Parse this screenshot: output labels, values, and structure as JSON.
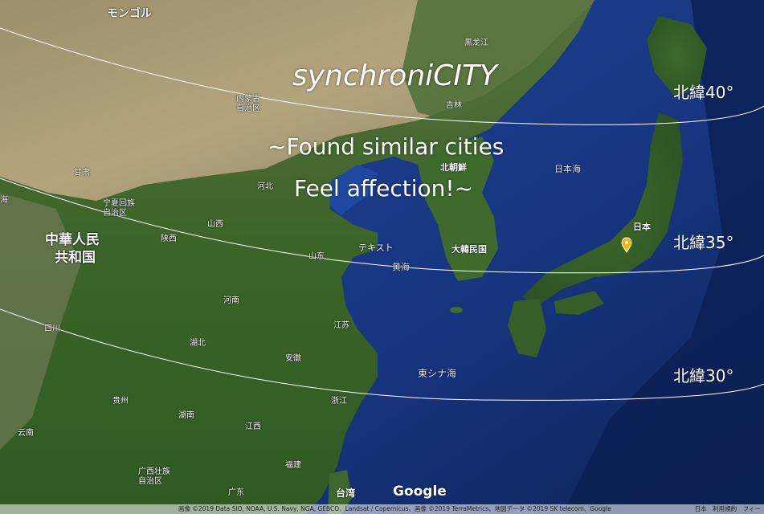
{
  "hero": {
    "title": "synchroniCITY",
    "tagline1": "~Found similar cities",
    "tagline2": "Feel affection!~"
  },
  "latitude_lines": [
    {
      "label": "北緯40°"
    },
    {
      "label": "北緯35°"
    },
    {
      "label": "北緯30°"
    }
  ],
  "labels": {
    "mongolia": "モンゴル",
    "heilongjiang": "黒龙江",
    "jilin": "吉林",
    "inner_mongolia": "内蒙古\n自治区",
    "gansu": "甘肃",
    "hebei": "河北",
    "ningxia": "宁夏回族\n自治区",
    "shanxi": "山西",
    "shaanxi": "陕西",
    "china_l1": "中華人民",
    "china_l2": "共和国",
    "shandong": "山东",
    "henan": "河南",
    "sichuan": "四川",
    "hubei": "湖北",
    "anhui": "安徽",
    "jiangsu": "江苏",
    "zhejiang": "浙江",
    "guizhou": "贵州",
    "hunan": "湖南",
    "jiangxi": "江西",
    "yunnan": "云南",
    "fujian": "福建",
    "guangxi": "广西壮族\n自治区",
    "guangdong": "广东",
    "taiwan": "台湾",
    "north_korea": "北朝鮮",
    "south_korea": "大韓民国",
    "japan": "日本",
    "sea_of_japan": "日本海",
    "yellow_sea": "黄海",
    "east_china_sea": "東シナ海",
    "text_marker": "テキスト",
    "qinghai_edge": "海"
  },
  "branding": {
    "google": "Google"
  },
  "attribution": {
    "text": "画像 ©2019 Data SIO, NOAA, U.S. Navy, NGA, GEBCO、Landsat / Copernicus、画像 ©2019 TerraMetrics、地図データ ©2019 SK telecom、Google",
    "links": "日本　利用規約　フィー"
  },
  "marker": {
    "color": "#f2b705",
    "name": "location-pin"
  },
  "colors": {
    "ocean": "#1a3a8c",
    "deep_ocean": "#0e2560",
    "land_green": "#3f6b2e",
    "land_desert": "#a99a73"
  }
}
